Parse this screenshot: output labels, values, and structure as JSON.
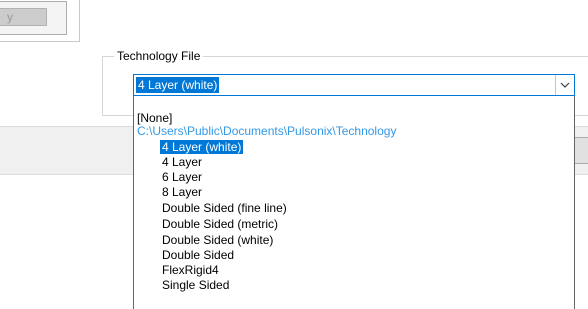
{
  "top_panel": {
    "partial_button_label": "y"
  },
  "technology_group": {
    "title": "Technology File",
    "combo_value": "4 Layer (white)"
  },
  "dropdown": {
    "items": [
      {
        "label": "[None]"
      },
      {
        "label": "C:\\Users\\Public\\Documents\\Pulsonix\\Technology"
      },
      {
        "label": "4 Layer (white)"
      },
      {
        "label": "4 Layer"
      },
      {
        "label": "6 Layer"
      },
      {
        "label": "8 Layer"
      },
      {
        "label": "Double Sided (fine line)"
      },
      {
        "label": "Double Sided (metric)"
      },
      {
        "label": "Double Sided (white)"
      },
      {
        "label": "Double Sided"
      },
      {
        "label": "FlexRigid4"
      },
      {
        "label": "Single Sided"
      }
    ],
    "selected_index": 2
  },
  "icons": {
    "combo_arrow": "chevron-down-icon"
  },
  "colors": {
    "selection": "#0078d7",
    "path_text": "#3399e6",
    "focus_border": "#0078d7"
  }
}
